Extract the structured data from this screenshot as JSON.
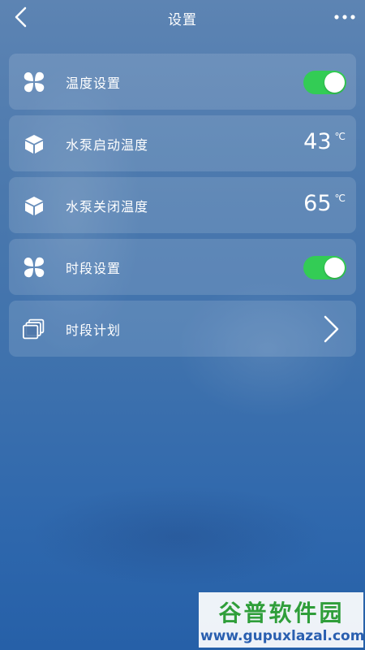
{
  "header": {
    "title": "设置",
    "back_icon": "chevron-left-icon",
    "more_icon": "more-dots-icon"
  },
  "rows": [
    {
      "icon": "fan-icon",
      "label": "温度设置",
      "control": "toggle",
      "on": true
    },
    {
      "icon": "cube-icon",
      "label": "水泵启动温度",
      "value": "43",
      "unit": "℃"
    },
    {
      "icon": "cube-icon",
      "label": "水泵关闭温度",
      "value": "65",
      "unit": "℃"
    },
    {
      "icon": "fan-icon",
      "label": "时段设置",
      "control": "toggle",
      "on": true
    },
    {
      "icon": "copy-icon",
      "label": "时段计划",
      "control": "chevron"
    }
  ],
  "watermark": {
    "title": "谷普软件园",
    "url": "www.gupuxlazal.com"
  },
  "colors": {
    "toggle_on": "#33cc55",
    "watermark_green": "#2f9e3a",
    "watermark_blue": "#2a5fb0"
  }
}
